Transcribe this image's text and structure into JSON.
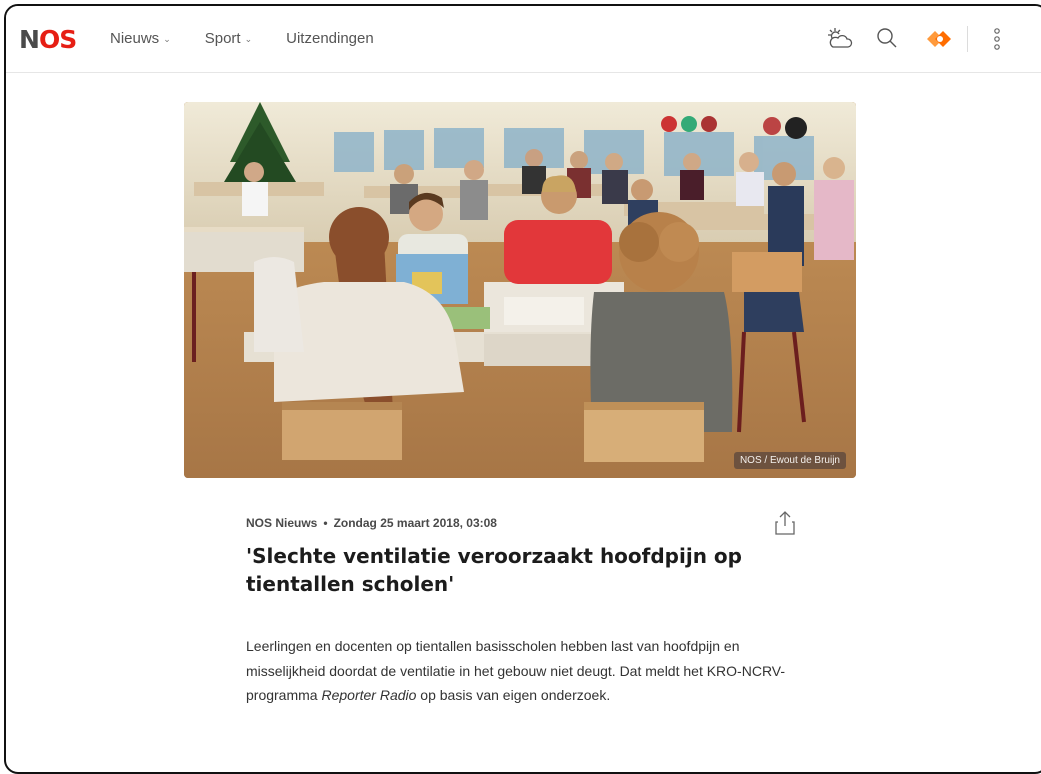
{
  "header": {
    "logo": "NOS",
    "nav": [
      {
        "label": "Nieuws",
        "has_dropdown": true
      },
      {
        "label": "Sport",
        "has_dropdown": true
      },
      {
        "label": "Uitzendingen",
        "has_dropdown": false
      }
    ],
    "icons": [
      "weather-icon",
      "search-icon",
      "npo-icon",
      "more-icon"
    ]
  },
  "article": {
    "image_credit": "NOS / Ewout de Bruijn",
    "source": "NOS Nieuws",
    "date": "Zondag 25 maart 2018, 03:08",
    "title": "'Slechte ventilatie veroorzaakt hoofdpijn op tientallen scholen'",
    "lead_part1": "Leerlingen en docenten op tientallen basisscholen hebben last van hoofdpijn en misselijkheid doordat de ventilatie in het gebouw niet deugt. Dat meldt het KRO-NCRV-programma ",
    "lead_italic": "Reporter Radio",
    "lead_part2": " op basis van eigen onderzoek."
  },
  "colors": {
    "brand_red": "#e61e14",
    "npo_orange": "#ff6d00",
    "text": "#1c1c1c"
  }
}
